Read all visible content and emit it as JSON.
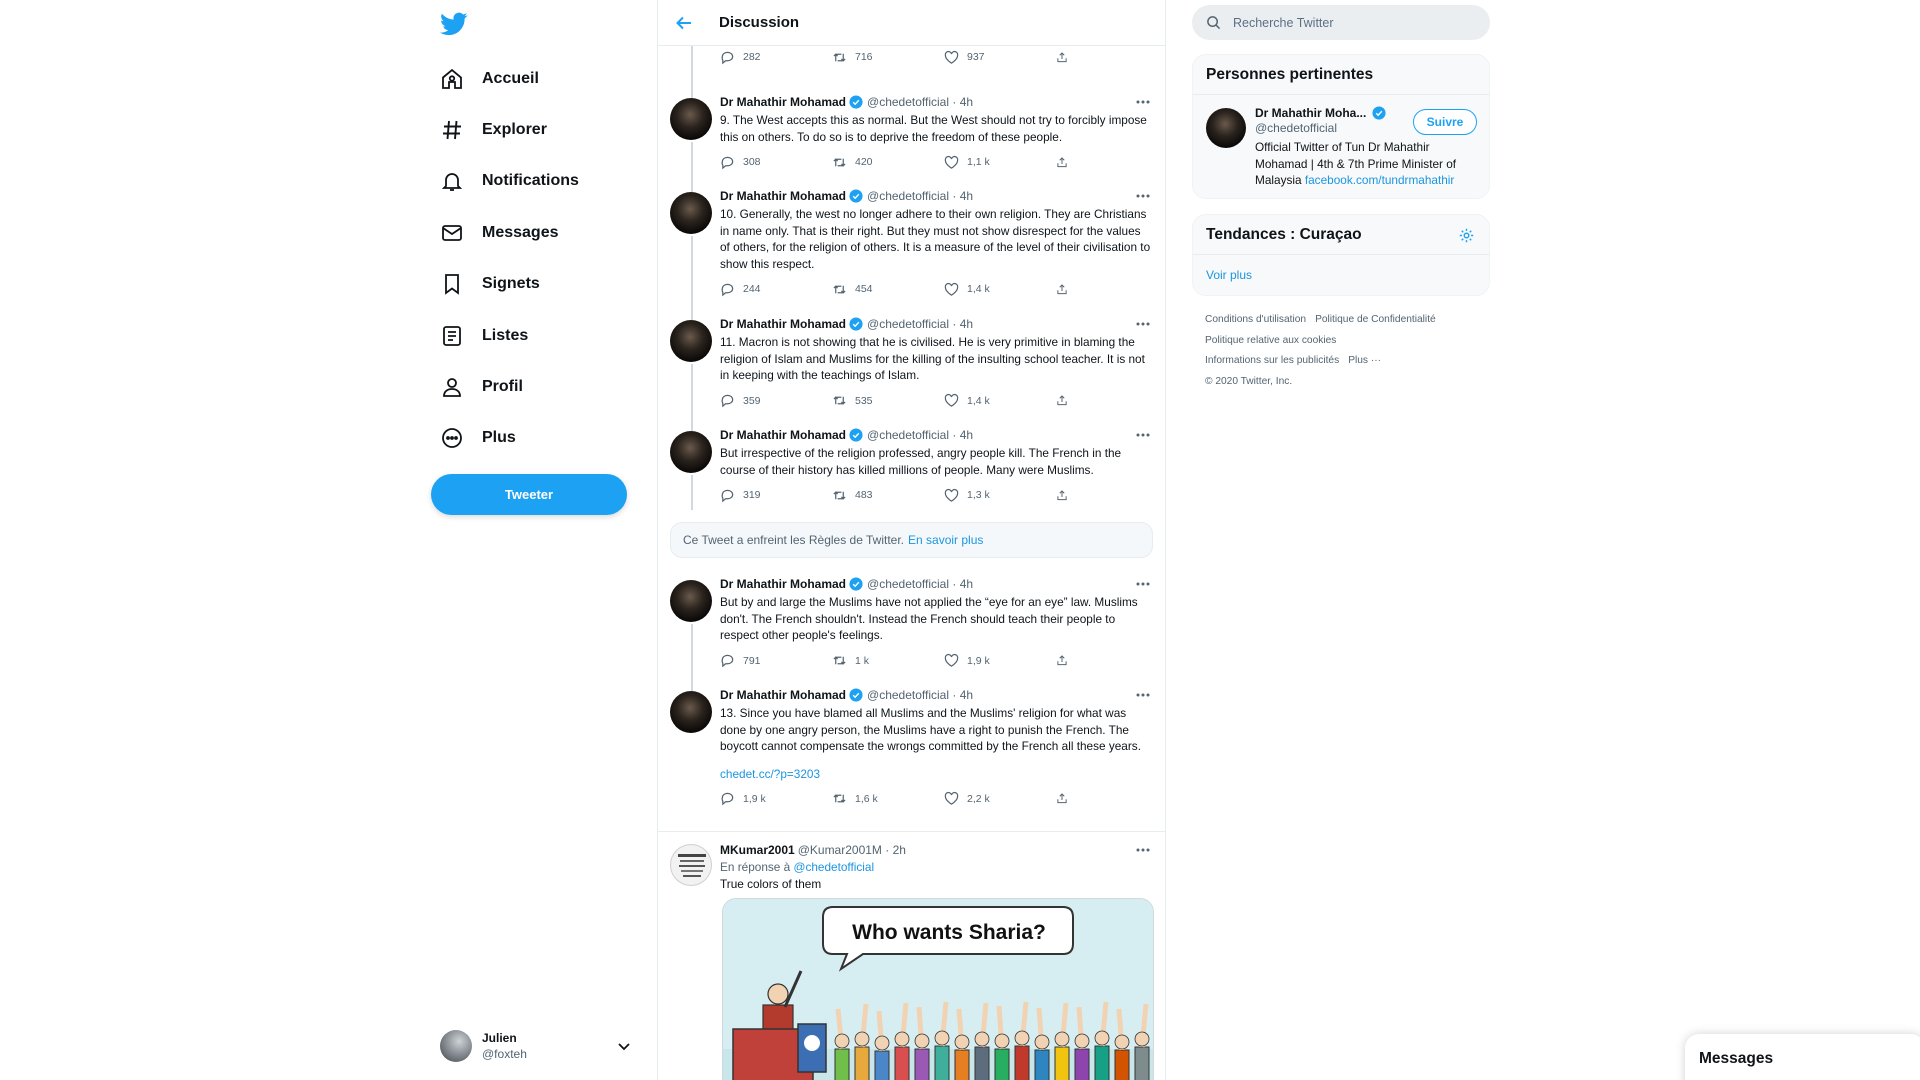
{
  "sidebar": {
    "nav": [
      {
        "label": "Accueil",
        "icon": "home-icon"
      },
      {
        "label": "Explorer",
        "icon": "hashtag-icon"
      },
      {
        "label": "Notifications",
        "icon": "bell-icon"
      },
      {
        "label": "Messages",
        "icon": "envelope-icon"
      },
      {
        "label": "Signets",
        "icon": "bookmark-icon"
      },
      {
        "label": "Listes",
        "icon": "list-icon"
      },
      {
        "label": "Profil",
        "icon": "person-icon"
      },
      {
        "label": "Plus",
        "icon": "more-circle-icon"
      }
    ],
    "tweet_button": "Tweeter",
    "account": {
      "name": "Julien",
      "handle": "@foxteh"
    }
  },
  "header": {
    "title": "Discussion"
  },
  "top_actions": {
    "replies": "282",
    "retweets": "716",
    "likes": "937"
  },
  "tweets": [
    {
      "name": "Dr Mahathir Mohamad",
      "meta": "@chedetofficial · 4h",
      "text": "9. The West accepts this as normal. But the West should not try to forcibly impose this on others. To do so is to deprive the freedom of these people.",
      "replies": "308",
      "retweets": "420",
      "likes": "1,1 k"
    },
    {
      "name": "Dr Mahathir Mohamad",
      "meta": "@chedetofficial · 4h",
      "text": "10. Generally, the west no longer adhere to their own religion. They are Christians in name only. That is their right. But they must not show disrespect for the values of others, for the religion of others. It is a measure of the level of their civilisation to show this respect.",
      "replies": "244",
      "retweets": "454",
      "likes": "1,4 k"
    },
    {
      "name": "Dr Mahathir Mohamad",
      "meta": "@chedetofficial · 4h",
      "text": "11. Macron is not showing that he is civilised. He is very primitive in blaming the religion of Islam and Muslims for the killing of the insulting school teacher. It is not in keeping with the teachings of Islam.",
      "replies": "359",
      "retweets": "535",
      "likes": "1,4 k"
    },
    {
      "name": "Dr Mahathir Mohamad",
      "meta": "@chedetofficial · 4h",
      "text": "But irrespective of the religion professed, angry people kill. The French in the course of their history has killed millions of people. Many were Muslims.",
      "replies": "319",
      "retweets": "483",
      "likes": "1,3 k"
    },
    {
      "name": "Dr Mahathir Mohamad",
      "meta": "@chedetofficial · 4h",
      "text": "But by and large the Muslims have not applied the “eye for an eye” law. Muslims don't. The French shouldn't. Instead the French should teach their people to respect other people's feelings.",
      "replies": "791",
      "retweets": "1 k",
      "likes": "1,9 k"
    },
    {
      "name": "Dr Mahathir Mohamad",
      "meta": "@chedetofficial · 4h",
      "text": "13. Since you have blamed all Muslims and the Muslims' religion for what was done by one angry person, the Muslims have a right to punish the French. The boycott cannot compensate the wrongs committed by the French all these years.",
      "link": "chedet.cc/?p=3203",
      "replies": "1,9 k",
      "retweets": "1,6 k",
      "likes": "2,2 k"
    }
  ],
  "violation": {
    "text": "Ce Tweet a enfreint les Règles de Twitter.",
    "link": "En savoir plus"
  },
  "reply": {
    "name": "MKumar2001",
    "meta": "@Kumar2001M · 2h",
    "reply_prefix": "En réponse à",
    "reply_to": "@chedetofficial",
    "text": "True colors of them",
    "image_caption": "Who wants Sharia?"
  },
  "right": {
    "search_placeholder": "Recherche Twitter",
    "people": {
      "title": "Personnes pertinentes",
      "name": "Dr Mahathir Moha...",
      "handle": "@chedetofficial",
      "follow": "Suivre",
      "bio": "Official Twitter of Tun Dr Mahathir Mohamad | 4th & 7th Prime Minister of Malaysia",
      "bio_link": "facebook.com/tundrmahathir"
    },
    "trends": {
      "title": "Tendances : Curaçao",
      "more": "Voir plus"
    },
    "footer": [
      "Conditions d'utilisation",
      "Politique de Confidentialité",
      "Politique relative aux cookies",
      "Informations sur les publicités",
      "Plus ···",
      "© 2020 Twitter, Inc."
    ]
  },
  "drawer": {
    "title": "Messages"
  },
  "colors": {
    "accent": "#1da1f2",
    "link": "#1b95e0",
    "muted": "#536471",
    "border": "#e6ecf0"
  }
}
